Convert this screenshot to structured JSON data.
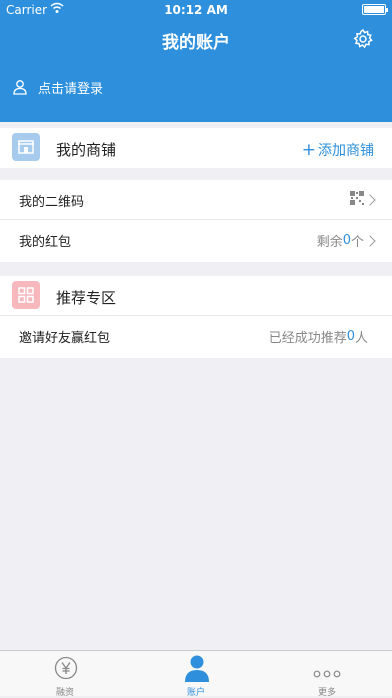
{
  "status_bar": {
    "carrier": "Carrier",
    "time": "10:12 AM"
  },
  "header": {
    "title": "我的账户",
    "login_text": "点击请登录"
  },
  "shop": {
    "title": "我的商铺",
    "action": "添加商铺"
  },
  "menu": {
    "qrcode_label": "我的二维码",
    "redpacket_label": "我的红包",
    "redpacket_prefix": "剩余",
    "redpacket_count": "0",
    "redpacket_unit": "个"
  },
  "recommend": {
    "title": "推荐专区",
    "invite_label": "邀请好友赢红包",
    "invite_prefix": "已经成功推荐",
    "invite_count": "0",
    "invite_unit": "人"
  },
  "tabs": [
    {
      "label": "融资",
      "icon": "yen-icon"
    },
    {
      "label": "账户",
      "icon": "person-icon"
    },
    {
      "label": "更多",
      "icon": "more-dots-icon"
    }
  ],
  "colors": {
    "accent": "#2e8fdd",
    "background": "#efeff4",
    "shop_icon": "#a6cbec",
    "recommend_icon": "#f6b8bd"
  }
}
